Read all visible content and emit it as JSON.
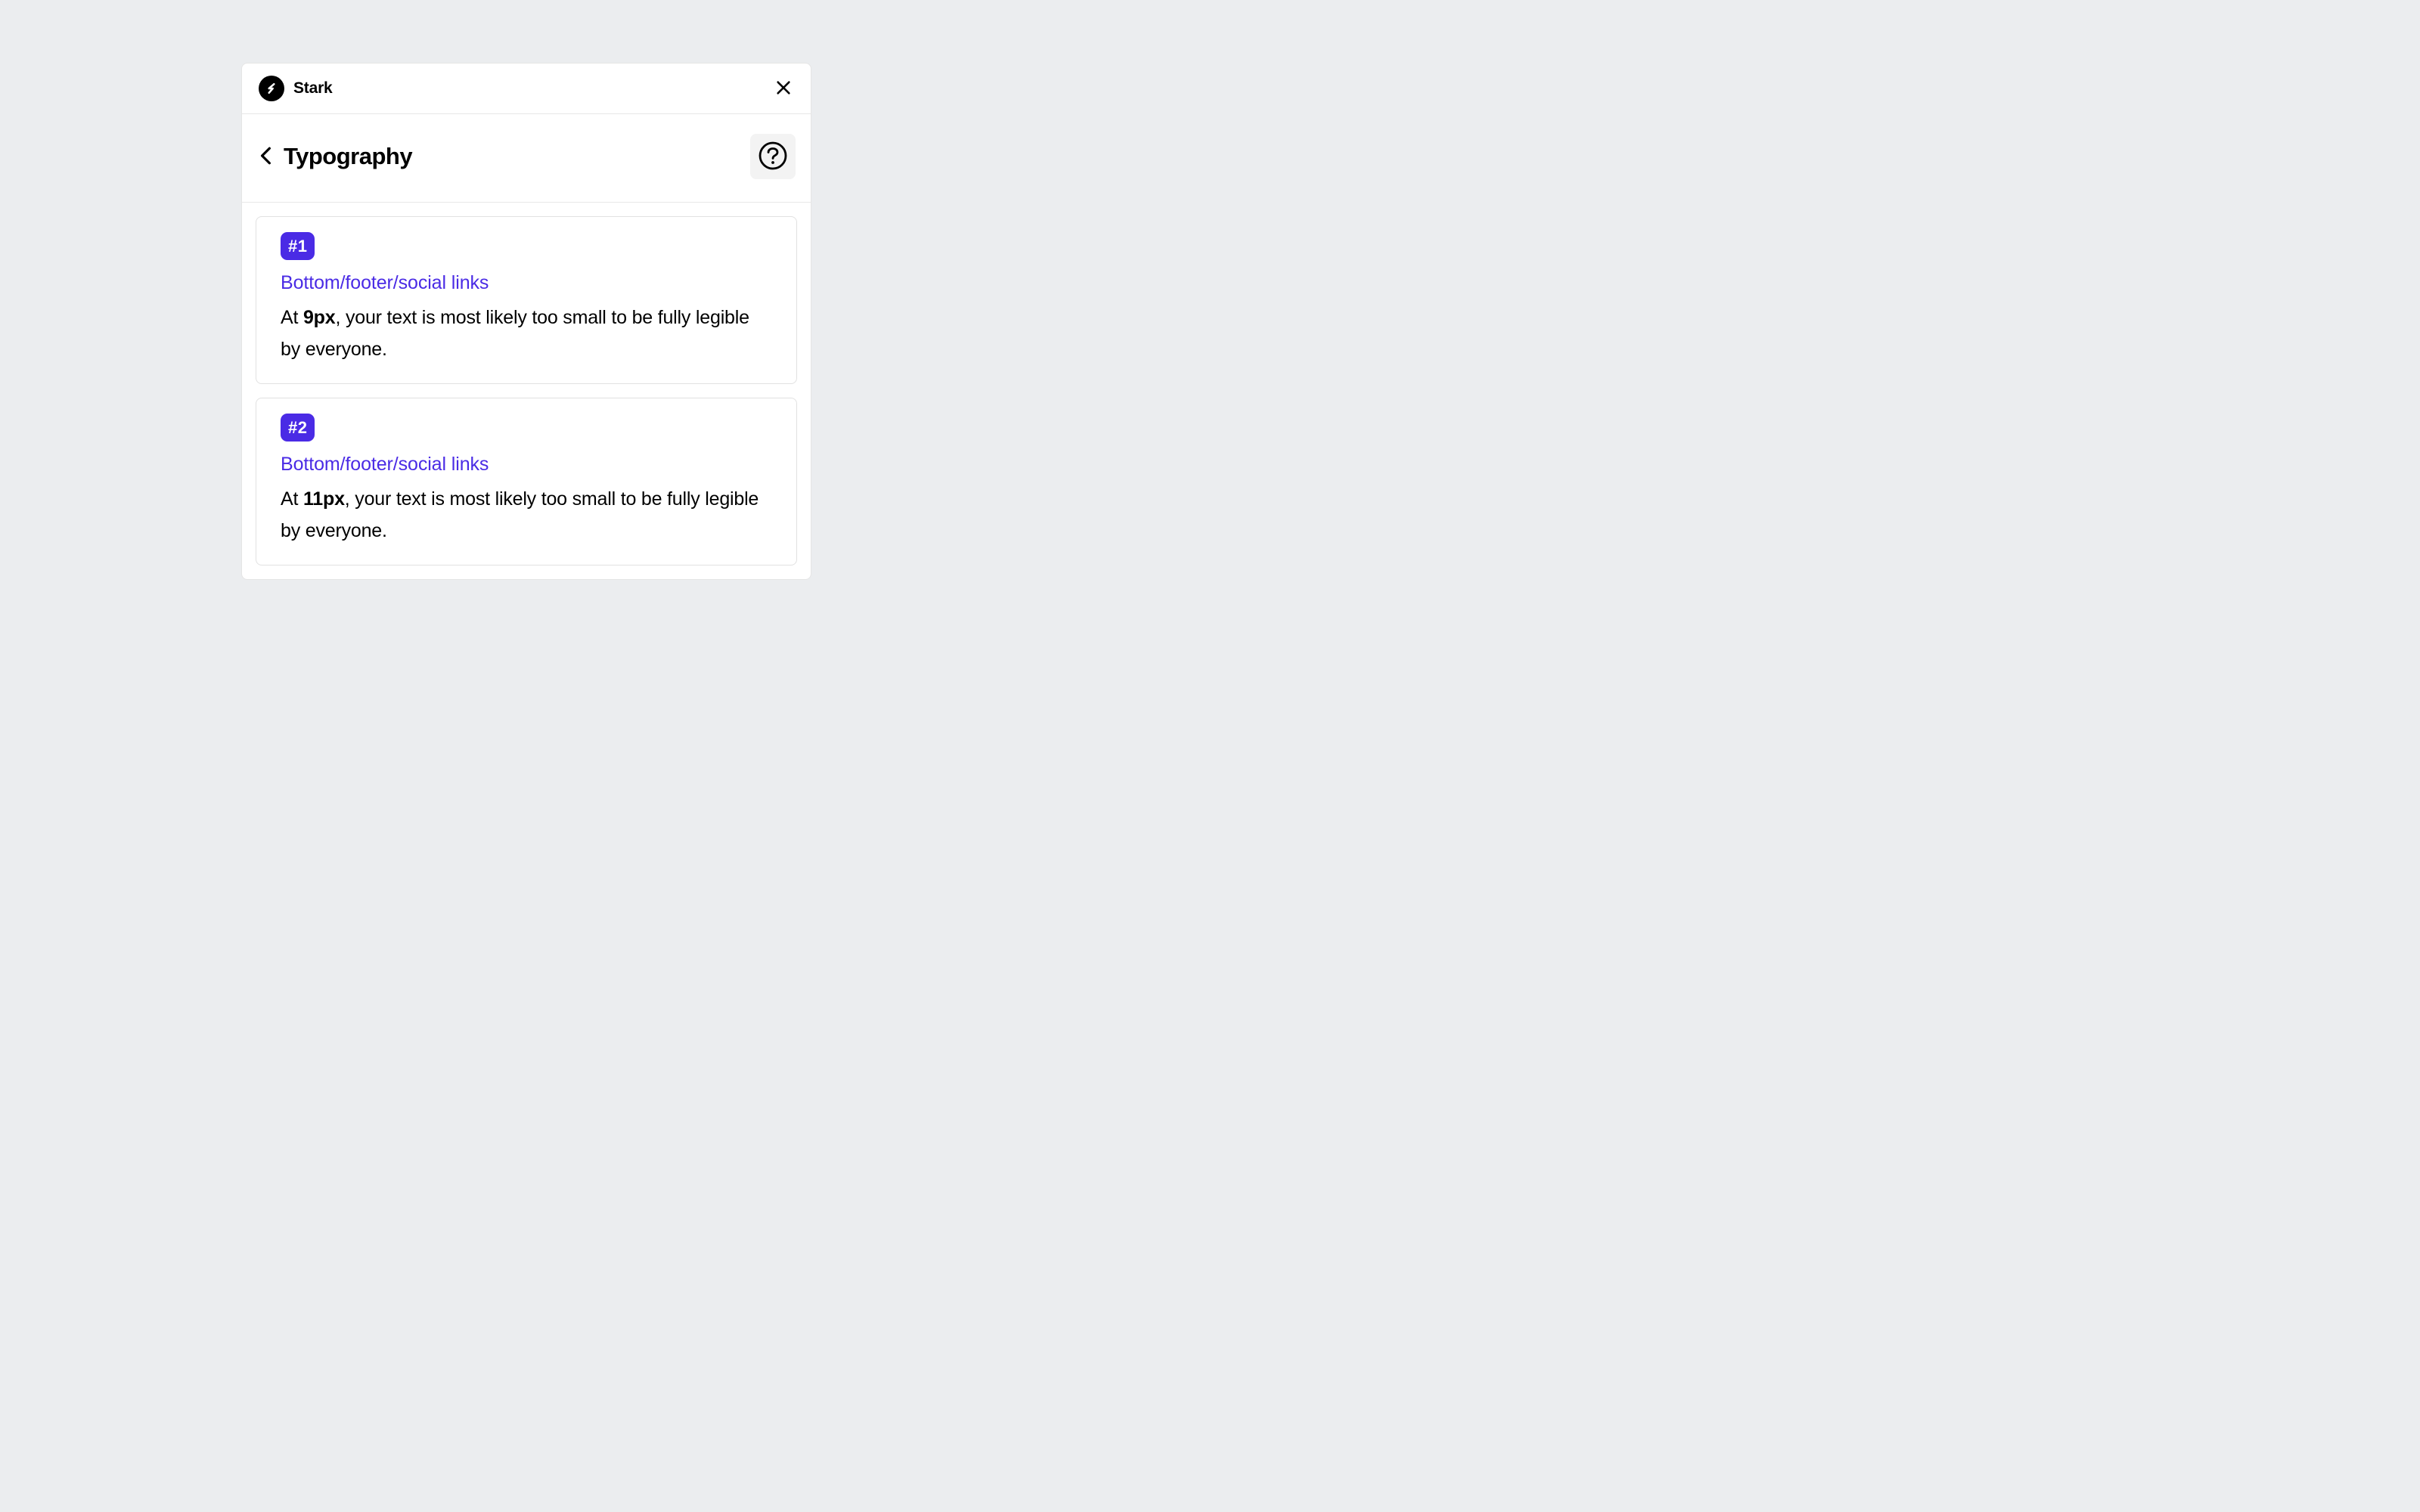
{
  "header": {
    "appName": "Stark"
  },
  "subheader": {
    "title": "Typography"
  },
  "issues": [
    {
      "badge": "#1",
      "path": "Bottom/footer/social links",
      "desc_prefix": "At ",
      "desc_size": "9px",
      "desc_suffix": ", your text is most likely too small to be fully legible by everyone."
    },
    {
      "badge": "#2",
      "path": "Bottom/footer/social links",
      "desc_prefix": "At ",
      "desc_size": "11px",
      "desc_suffix": ", your text is most likely too small to be fully legible by everyone."
    }
  ]
}
